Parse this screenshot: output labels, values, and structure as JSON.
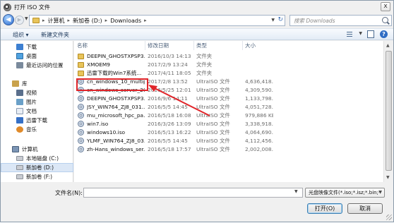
{
  "window": {
    "title": "打开 ISO 文件",
    "close_label": "x"
  },
  "address": {
    "crumbs": [
      "计算机",
      "新加卷 (D:)",
      "Downloads"
    ],
    "separator": "▸"
  },
  "search": {
    "placeholder": "搜索 Downloads"
  },
  "toolbar": {
    "organize_label": "组织 ▾",
    "new_folder_label": "新建文件夹"
  },
  "sidebar": {
    "items": [
      {
        "label": "下载",
        "icon": "download-icon"
      },
      {
        "label": "桌面",
        "icon": "desktop-icon"
      },
      {
        "label": "最近访问的位置",
        "icon": "recent-places-icon"
      },
      {
        "label": "库",
        "icon": "library-icon"
      },
      {
        "label": "视频",
        "icon": "video-icon"
      },
      {
        "label": "图片",
        "icon": "picture-icon"
      },
      {
        "label": "文档",
        "icon": "document-icon"
      },
      {
        "label": "迅雷下载",
        "icon": "thunder-icon"
      },
      {
        "label": "音乐",
        "icon": "music-icon"
      },
      {
        "label": "计算机",
        "icon": "computer-icon"
      },
      {
        "label": "本地磁盘 (C:)",
        "icon": "drive-icon"
      },
      {
        "label": "新加卷 (D:)",
        "icon": "drive-icon",
        "selected": true
      },
      {
        "label": "新加卷 (F:)",
        "icon": "drive-icon"
      }
    ]
  },
  "filelist": {
    "columns": {
      "name": "名称",
      "date": "修改日期",
      "type": "类型",
      "size": "大小"
    },
    "rows": [
      {
        "name": "DEEPIN_GHOSTXPSP3...",
        "date": "2016/10/3 14:13",
        "type": "文件夹",
        "size": "",
        "kind": "folder"
      },
      {
        "name": "XMOEM9",
        "date": "2017/2/9 13:24",
        "type": "文件夹",
        "size": "",
        "kind": "folder"
      },
      {
        "name": "迅雷下载的Win7系统...",
        "date": "2017/4/11 18:05",
        "type": "文件夹",
        "size": "",
        "kind": "folder"
      },
      {
        "name": "cn_windows_10_multip...",
        "date": "2017/2/8 13:52",
        "type": "UltraISO 文件",
        "size": "4,636,418...",
        "kind": "iso"
      },
      {
        "name": "cn_windows_server_20...",
        "date": "2016/5/25 12:01",
        "type": "UltraISO 文件",
        "size": "4,309,590...",
        "kind": "iso"
      },
      {
        "name": "DEEPIN_GHOSTXPSP3...",
        "date": "2016/9/6 14:11",
        "type": "UltraISO 文件",
        "size": "1,133,798...",
        "kind": "iso"
      },
      {
        "name": "JSY_WIN764_ZJ8_031...",
        "date": "2016/5/5 14:45",
        "type": "UltraISO 文件",
        "size": "4,051,728...",
        "kind": "iso"
      },
      {
        "name": "mu_microsoft_hpc_pa...",
        "date": "2016/5/18 16:08",
        "type": "UltraISO 文件",
        "size": "979,886 KB",
        "kind": "iso"
      },
      {
        "name": "win7.iso",
        "date": "2016/3/26 13:09",
        "type": "UltraISO 文件",
        "size": "3,338,918...",
        "kind": "iso"
      },
      {
        "name": "windows10.iso",
        "date": "2016/5/13 16:22",
        "type": "UltraISO 文件",
        "size": "4,064,690...",
        "kind": "iso"
      },
      {
        "name": "YLMF_WIN764_ZJ8_03...",
        "date": "2016/5/5 14:45",
        "type": "UltraISO 文件",
        "size": "4,112,456...",
        "kind": "iso"
      },
      {
        "name": "zh-Hans_windows_ser...",
        "date": "2016/5/18 17:57",
        "type": "UltraISO 文件",
        "size": "2,002,008...",
        "kind": "iso"
      }
    ]
  },
  "bottom": {
    "filename_label": "文件名(N):",
    "filename_value": "",
    "filter_value": "光盘映像文件(*.iso;*.isz;*.bin;*",
    "open_label": "打开(O)",
    "cancel_label": "取消"
  },
  "colors": {
    "annotation": "#e0252a",
    "selection": "#dbe7f6"
  }
}
